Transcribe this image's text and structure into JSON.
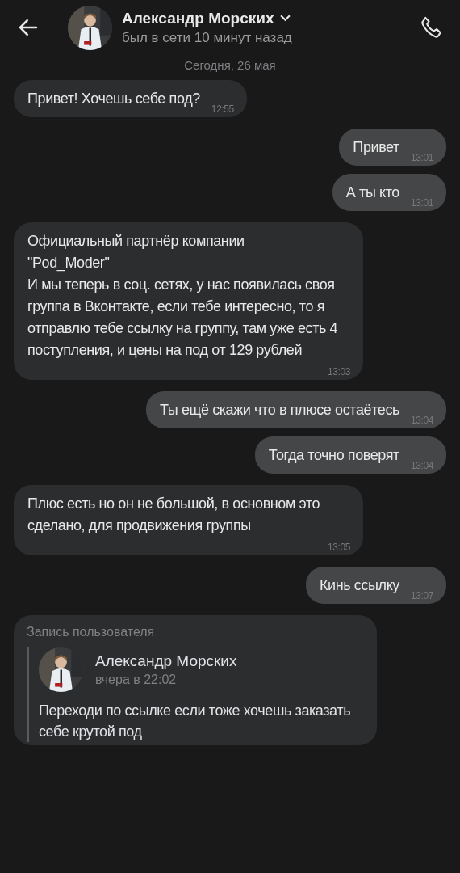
{
  "header": {
    "name": "Александр Морских",
    "status": "был в сети 10 минут назад"
  },
  "date_separator": "Сегодня, 26 мая",
  "messages": [
    {
      "outgoing": false,
      "text": "Привет! Хочешь себе под?",
      "time": "12:55"
    },
    {
      "outgoing": true,
      "text": "Привет",
      "time": "13:01"
    },
    {
      "outgoing": true,
      "text": "А ты кто",
      "time": "13:01"
    },
    {
      "outgoing": false,
      "text": "Официальный партнёр компании\n\"Pod_Moder\"\nИ мы теперь в соц. сетях, у нас появилась своя группа в Вконтакте, если тебе интересно, то я отправлю тебе ссылку на группу, там уже есть 4 поступления, и цены на под от 129 рублей",
      "time": "13:03"
    },
    {
      "outgoing": true,
      "text": "Ты ещё скажи что в плюсе остаётесь",
      "time": "13:04"
    },
    {
      "outgoing": true,
      "text": "Тогда точно поверят",
      "time": "13:04"
    },
    {
      "outgoing": false,
      "text": "Плюс есть но он не большой, в основном это сделано, для продвижения группы",
      "time": "13:05"
    },
    {
      "outgoing": true,
      "text": "Кинь ссылку",
      "time": "13:07"
    }
  ],
  "shared_post": {
    "label": "Запись пользователя",
    "author": "Александр Морских",
    "date": "вчера в 22:02",
    "text": "Переходи по ссылке если тоже хочешь заказать себе крутой под"
  }
}
